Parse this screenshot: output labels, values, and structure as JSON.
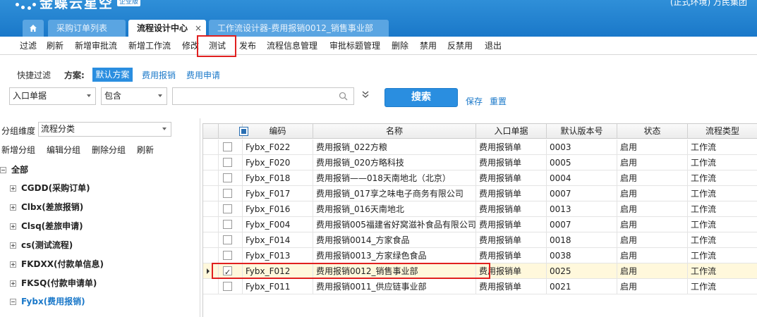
{
  "app": {
    "logo_text": "金蝶云星空",
    "edition": "企业版",
    "user_info": "(正式环境) 万民集团"
  },
  "tabs": [
    {
      "label": "采购订单列表",
      "active": false
    },
    {
      "label": "流程设计中心",
      "active": true,
      "close": "×"
    },
    {
      "label": "工作流设计器-费用报销0012_销售事业部",
      "active": false
    }
  ],
  "toolbar": [
    "过滤",
    "刷新",
    "新增审批流",
    "新增工作流",
    "修改",
    "测试",
    "发布",
    "流程信息管理",
    "审批标题管理",
    "删除",
    "禁用",
    "反禁用",
    "退出"
  ],
  "filter": {
    "quick_filter_label": "快捷过滤",
    "scheme_label": "方案:",
    "schemes": [
      "默认方案",
      "费用报销",
      "费用申请"
    ],
    "field": "入口单据",
    "operator": "包含",
    "value": "",
    "search_label": "搜索",
    "save_label": "保存",
    "reset_label": "重置"
  },
  "left": {
    "group_dim_label": "分组维度",
    "group_dim_value": "流程分类",
    "actions": [
      "新增分组",
      "编辑分组",
      "删除分组",
      "刷新"
    ],
    "tree": [
      {
        "label": "全部",
        "expanded": true
      },
      {
        "label": "CGDD(采购订单)",
        "expanded": false
      },
      {
        "label": "Clbx(差旅报销)",
        "expanded": false
      },
      {
        "label": "Clsq(差旅申请)",
        "expanded": false
      },
      {
        "label": "cs(测试流程)",
        "expanded": false
      },
      {
        "label": "FKDXX(付款单信息)",
        "expanded": false
      },
      {
        "label": "FKSQ(付款申请单)",
        "expanded": false
      },
      {
        "label": "Fybx(费用报销)",
        "expanded": true,
        "selected": true
      }
    ]
  },
  "grid": {
    "columns": [
      "编码",
      "名称",
      "入口单据",
      "默认版本号",
      "状态",
      "流程类型"
    ],
    "rows": [
      {
        "checked": false,
        "code": "Fybx_F022",
        "name": "费用报销_022方粮",
        "entry": "费用报销单",
        "version": "0003",
        "status": "启用",
        "type": "工作流"
      },
      {
        "checked": false,
        "code": "Fybx_F020",
        "name": "费用报销_020方略科技",
        "entry": "费用报销单",
        "version": "0005",
        "status": "启用",
        "type": "工作流"
      },
      {
        "checked": false,
        "code": "Fybx_F018",
        "name": "费用报销——018天南地北（北京）",
        "entry": "费用报销单",
        "version": "0004",
        "status": "启用",
        "type": "工作流"
      },
      {
        "checked": false,
        "code": "Fybx_F017",
        "name": "费用报销_017享之味电子商务有限公司",
        "entry": "费用报销单",
        "version": "0007",
        "status": "启用",
        "type": "工作流"
      },
      {
        "checked": false,
        "code": "Fybx_F016",
        "name": "费用报销_016天南地北",
        "entry": "费用报销单",
        "version": "0013",
        "status": "启用",
        "type": "工作流"
      },
      {
        "checked": false,
        "code": "Fybx_F004",
        "name": "费用报销005福建省好窝滋补食品有限公司",
        "entry": "费用报销单",
        "version": "0007",
        "status": "启用",
        "type": "工作流"
      },
      {
        "checked": false,
        "code": "Fybx_F014",
        "name": "费用报销0014_方家食品",
        "entry": "费用报销单",
        "version": "0018",
        "status": "启用",
        "type": "工作流"
      },
      {
        "checked": false,
        "code": "Fybx_F013",
        "name": "费用报销0013_方家绿色食品",
        "entry": "费用报销单",
        "version": "0038",
        "status": "启用",
        "type": "工作流"
      },
      {
        "checked": true,
        "code": "Fybx_F012",
        "name": "费用报销0012_销售事业部",
        "entry": "费用报销单",
        "version": "0025",
        "status": "启用",
        "type": "工作流"
      },
      {
        "checked": false,
        "code": "Fybx_F011",
        "name": "费用报销0011_供应链事业部",
        "entry": "费用报销单",
        "version": "0021",
        "status": "启用",
        "type": "工作流"
      }
    ]
  },
  "colors": {
    "header_blue": "#1a78c9",
    "accent_blue": "#2a8ee0",
    "highlight_red": "#e02020",
    "selected_row": "#fff8dc"
  }
}
